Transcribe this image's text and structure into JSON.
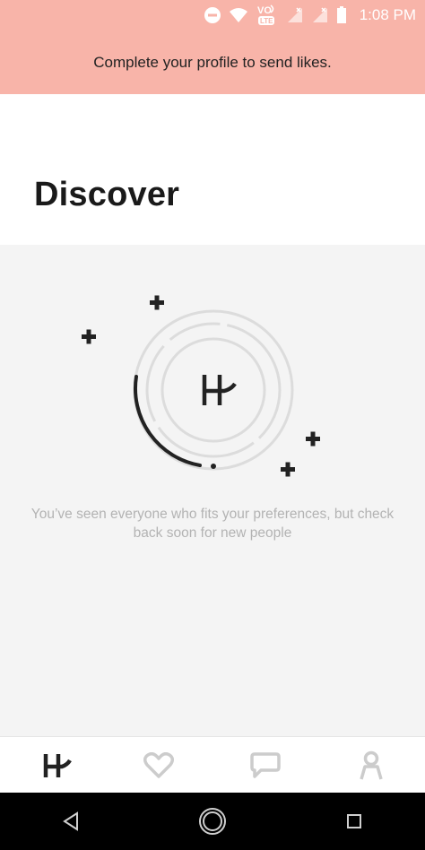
{
  "status_bar": {
    "time": "1:08 PM",
    "volte_label": "VO",
    "lte_label": "LTE",
    "icons": [
      "do-not-disturb-icon",
      "wifi-icon",
      "volte-icon",
      "signal-icon",
      "signal-icon",
      "battery-icon"
    ]
  },
  "banner": {
    "text": "Complete your profile to send likes."
  },
  "page": {
    "title": "Discover"
  },
  "empty_state": {
    "message": "You’ve seen everyone who fits your preferences, but check back soon for new people"
  },
  "tabs": [
    {
      "name": "discover",
      "icon": "hinge-logo-icon",
      "active": true
    },
    {
      "name": "likes",
      "icon": "heart-icon",
      "active": false
    },
    {
      "name": "matches",
      "icon": "chat-icon",
      "active": false
    },
    {
      "name": "profile",
      "icon": "person-icon",
      "active": false
    }
  ],
  "colors": {
    "banner_bg": "#f8b4a9",
    "discover_bg": "#f4f4f4",
    "active_tab": "#222222",
    "inactive_tab": "#cccccc"
  }
}
